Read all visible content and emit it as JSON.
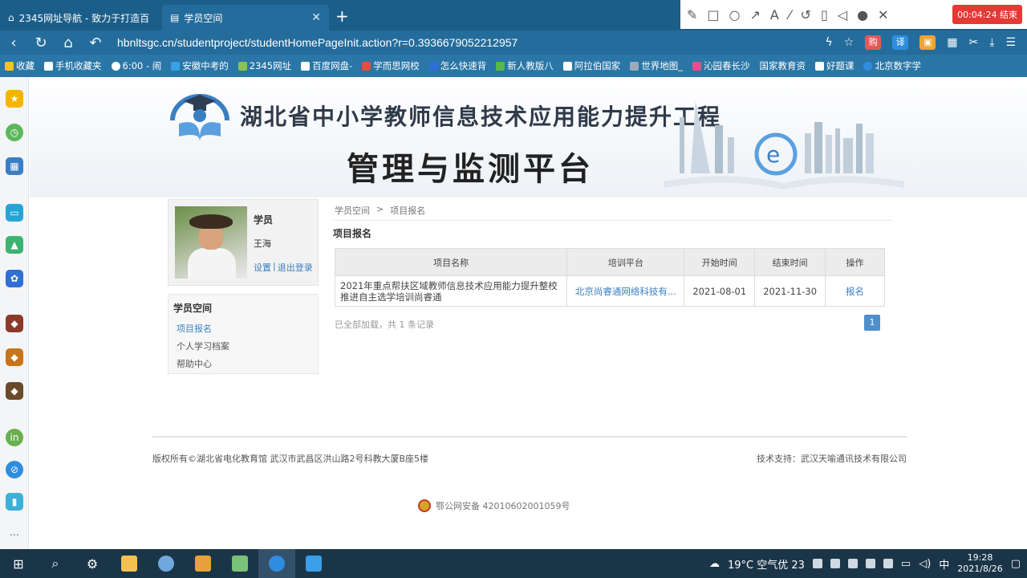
{
  "browser": {
    "tabs": [
      {
        "title": "2345网址导航 - 致力于打造百",
        "active": false
      },
      {
        "title": "学员空间",
        "active": true
      }
    ],
    "new_tab": "+",
    "url": "hbnltsgc.cn/studentproject/studentHomePageInit.action?r=0.3936679052212957",
    "recording": "00:04:24 结束",
    "annotation_tools": [
      "pencil-icon",
      "rect-icon",
      "circle-icon",
      "arrow-icon",
      "text-icon",
      "highlighter-icon",
      "undo-icon",
      "trash-icon",
      "speaker-icon",
      "mic-icon",
      "close-icon"
    ],
    "bookmarks": [
      "收藏",
      "手机收藏夹",
      "6:00 - 闹",
      "安徽中考的",
      "2345网址",
      "百度网盘-",
      "学而思网校",
      "怎么快速背",
      "新人教版八",
      "阿拉伯国家",
      "世界地图_",
      "沁园春长沙",
      "国家教育资",
      "好题课",
      "北京数字学"
    ]
  },
  "banner": {
    "title": "湖北省中小学教师信息技术应用能力提升工程",
    "subtitle": "管理与监测平台"
  },
  "profile": {
    "role": "学员",
    "name": "王海",
    "settings": "设置",
    "separator": "|",
    "logout": "退出登录"
  },
  "sidemenu": {
    "heading": "学员空间",
    "items": [
      "项目报名",
      "个人学习档案",
      "帮助中心"
    ]
  },
  "breadcrumb": {
    "home": "学员空间",
    "sep": ">",
    "current": "项目报名"
  },
  "section_title": "项目报名",
  "table": {
    "headers": [
      "项目名称",
      "培训平台",
      "开始时间",
      "结束时间",
      "操作"
    ],
    "rows": [
      {
        "name": "2021年重点帮扶区域教师信息技术应用能力提升整校推进自主选学培训尚睿通",
        "platform": "北京尚睿通网络科技有...",
        "start": "2021-08-01",
        "end": "2021-11-30",
        "action": "报名"
      }
    ]
  },
  "loaded_text": "已全部加载，共 1 条记录",
  "pager": "1",
  "footer": {
    "left": "版权所有©湖北省电化教育馆   武汉市武昌区洪山路2号科教大厦B座5楼",
    "right": "技术支持：武汉天喻通讯技术有限公司",
    "icp": "鄂公网安备 42010602001059号"
  },
  "taskbar": {
    "weather": "19°C 空气优 23",
    "ime": "中",
    "time": "19:28",
    "date": "2021/8/26"
  }
}
